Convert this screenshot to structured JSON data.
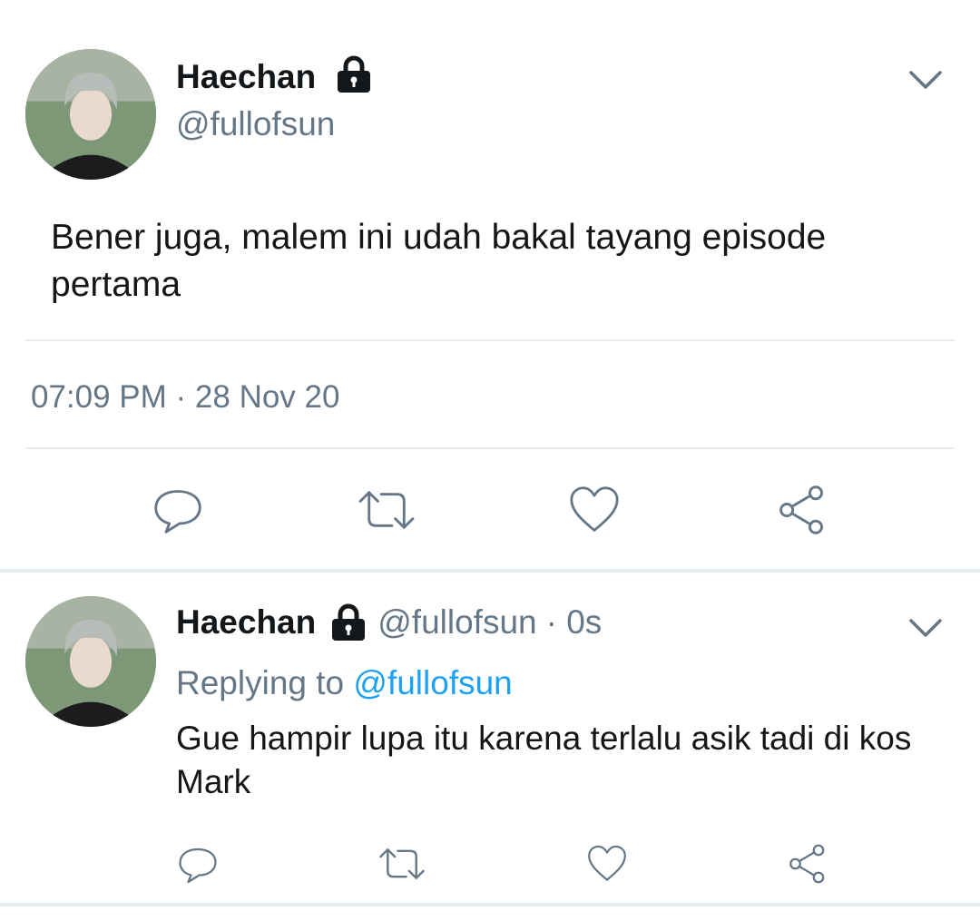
{
  "main_tweet": {
    "display_name": "Haechan",
    "handle": "@fullofsun",
    "text_line1": "Bener juga, malem ini udah bakal tayang episode",
    "text_line2": "pertama",
    "timestamp": "07:09 PM · 28 Nov 20",
    "icons": [
      "lock-icon",
      "chevron-down-icon",
      "reply-icon",
      "retweet-icon",
      "like-icon",
      "share-icon"
    ]
  },
  "reply_tweet": {
    "display_name": "Haechan",
    "handle": "@fullofsun",
    "time": "· 0s",
    "replying_prefix": "Replying to",
    "replying_handle": "@fullofsun",
    "text_line1": "Gue hampir lupa itu karena terlalu asik tadi di kos",
    "text_line2": "Mark"
  },
  "colors": {
    "text": "#14171a",
    "secondary": "#657786",
    "link": "#1da1f2",
    "divider": "#e6ecf0"
  }
}
